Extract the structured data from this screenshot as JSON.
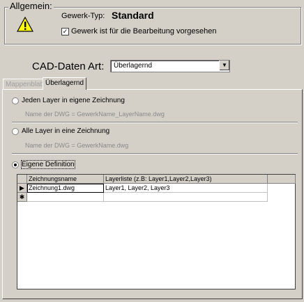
{
  "general": {
    "legend": "Allgemein:",
    "gewerk_typ_label": "Gewerk-Typ:",
    "gewerk_typ_value": "Standard",
    "checkbox_label": "Gewerk ist für die Bearbeitung vorgesehen",
    "checkbox_checked": true
  },
  "cad": {
    "label": "CAD-Daten Art:",
    "selected": "Überlagernd"
  },
  "tabs": [
    {
      "label": "Mappenblatt",
      "active": false
    },
    {
      "label": "Überlagernd",
      "active": true
    }
  ],
  "options": {
    "opt1_label": "Jeden Layer in eigene Zeichnung",
    "opt1_hint": "Name der DWG = GewerkName_LayerName.dwg",
    "opt2_label": "Alle Layer in eine Zeichnung",
    "opt2_hint": "Name der DWG = GewerkName.dwg",
    "opt3_label": "Eigene Definition",
    "selected": 3
  },
  "grid": {
    "columns": [
      "Zeichnungsname",
      "Layerliste (z.B: Layer1,Layer2,Layer3)"
    ],
    "rows": [
      [
        "Zeichnung1.dwg",
        "Layer1, Layer2, Layer3"
      ]
    ],
    "current_row_marker": "▶",
    "new_row_marker": "✱"
  }
}
